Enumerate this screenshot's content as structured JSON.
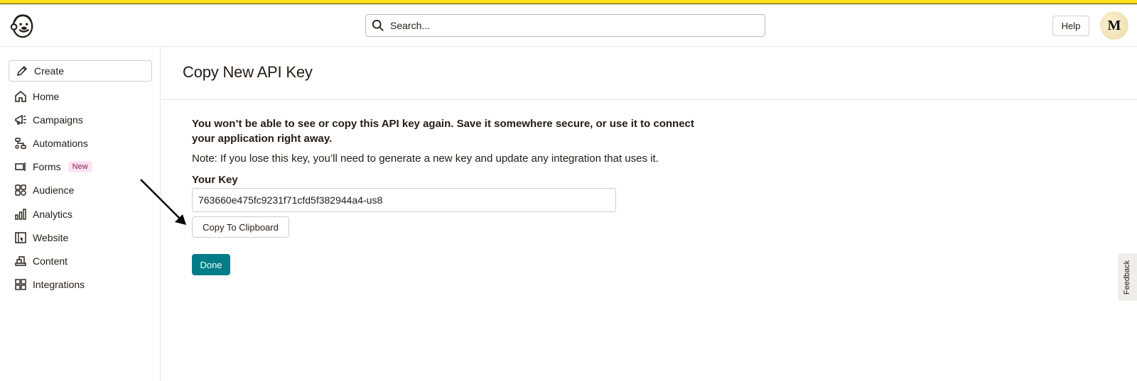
{
  "header": {
    "search_placeholder": "Search...",
    "help_label": "Help",
    "avatar_initial": "M"
  },
  "sidebar": {
    "create_label": "Create",
    "items": [
      {
        "label": "Home",
        "icon": "home-icon"
      },
      {
        "label": "Campaigns",
        "icon": "megaphone-icon"
      },
      {
        "label": "Automations",
        "icon": "automations-icon"
      },
      {
        "label": "Forms",
        "icon": "forms-icon",
        "badge": "New"
      },
      {
        "label": "Audience",
        "icon": "audience-icon"
      },
      {
        "label": "Analytics",
        "icon": "analytics-icon"
      },
      {
        "label": "Website",
        "icon": "website-icon"
      },
      {
        "label": "Content",
        "icon": "content-icon"
      },
      {
        "label": "Integrations",
        "icon": "integrations-icon"
      }
    ]
  },
  "main": {
    "title": "Copy New API Key",
    "warning": "You won’t be able to see or copy this API key again. Save it somewhere secure, or use it to connect your application right away.",
    "note": "Note: If you lose this key, you’ll need to generate a new key and update any integration that uses it.",
    "key_label": "Your Key",
    "key_value": "763660e475fc9231f71cfd5f382944a4-us8",
    "copy_button": "Copy To Clipboard",
    "done_button": "Done"
  },
  "feedback_label": "Feedback",
  "colors": {
    "brand_yellow": "#ffe01b",
    "primary_button": "#007c89",
    "text": "#241c15",
    "badge_bg": "#fde3f0"
  }
}
